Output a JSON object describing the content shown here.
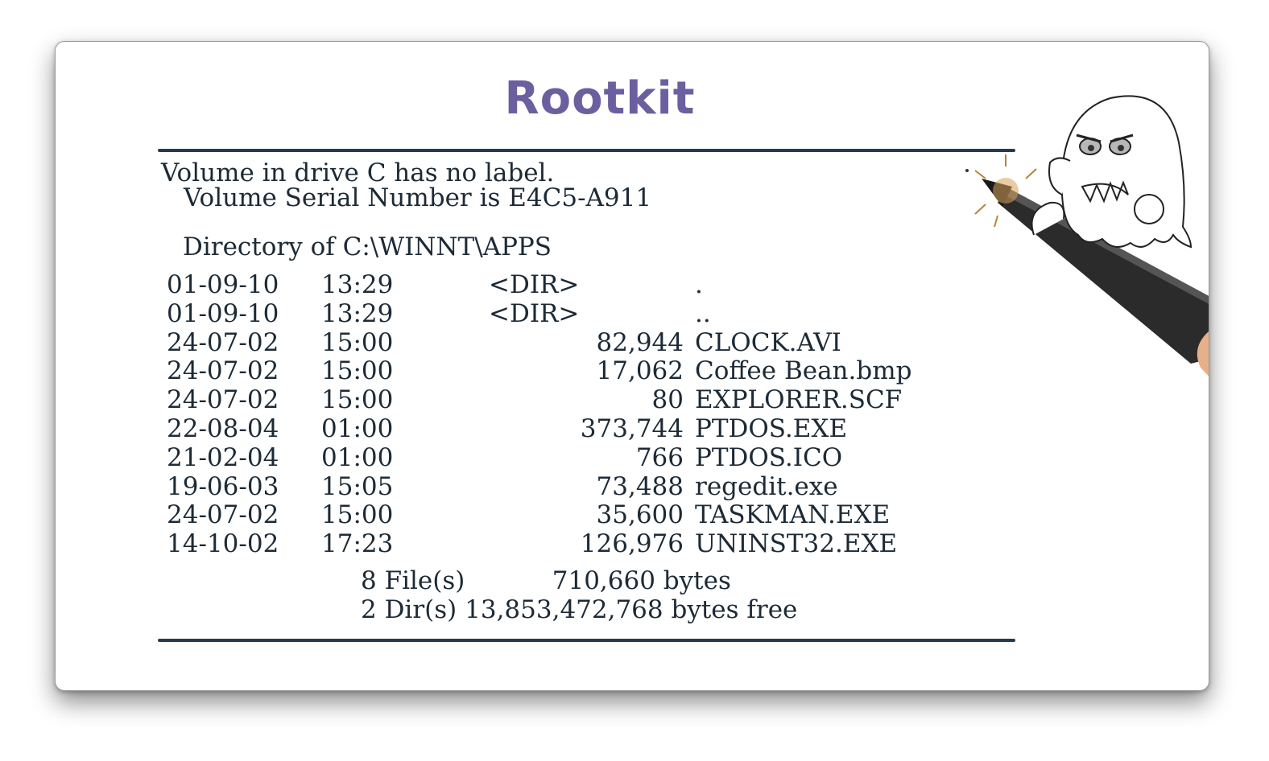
{
  "title": "Rootkit",
  "header": {
    "line1": "Volume in drive C has no label.",
    "line2": "Volume Serial Number is E4C5-A911",
    "line3": "Directory of C:\\WINNT\\APPS"
  },
  "entries": [
    {
      "date": "01-09-10",
      "time": "13:29",
      "dir": "<DIR>",
      "size": "",
      "name": "."
    },
    {
      "date": "01-09-10",
      "time": "13:29",
      "dir": "<DIR>",
      "size": "",
      "name": ".."
    },
    {
      "date": "24-07-02",
      "time": "15:00",
      "dir": "",
      "size": "82,944",
      "name": "CLOCK.AVI"
    },
    {
      "date": "24-07-02",
      "time": "15:00",
      "dir": "",
      "size": "17,062",
      "name": "Coffee Bean.bmp"
    },
    {
      "date": "24-07-02",
      "time": "15:00",
      "dir": "",
      "size": "80",
      "name": "EXPLORER.SCF"
    },
    {
      "date": "22-08-04",
      "time": "01:00",
      "dir": "",
      "size": "373,744",
      "name": "PTDOS.EXE"
    },
    {
      "date": "21-02-04",
      "time": "01:00",
      "dir": "",
      "size": "766",
      "name": "PTDOS.ICO"
    },
    {
      "date": "19-06-03",
      "time": "15:05",
      "dir": "",
      "size": "73,488",
      "name": "regedit.exe"
    },
    {
      "date": "24-07-02",
      "time": "15:00",
      "dir": "",
      "size": "35,600",
      "name": "TASKMAN.EXE"
    },
    {
      "date": "14-10-02",
      "time": "17:23",
      "dir": "",
      "size": "126,976",
      "name": "UNINST32.EXE"
    }
  ],
  "summary": {
    "files": "8 File(s)           710,660 bytes",
    "dirs": "2 Dir(s) 13,853,472,768 bytes free"
  },
  "illustration": {
    "icon": "ghost-with-pen-illustration",
    "title_color": "#6b5fa0",
    "rule_color": "#263a4d"
  }
}
